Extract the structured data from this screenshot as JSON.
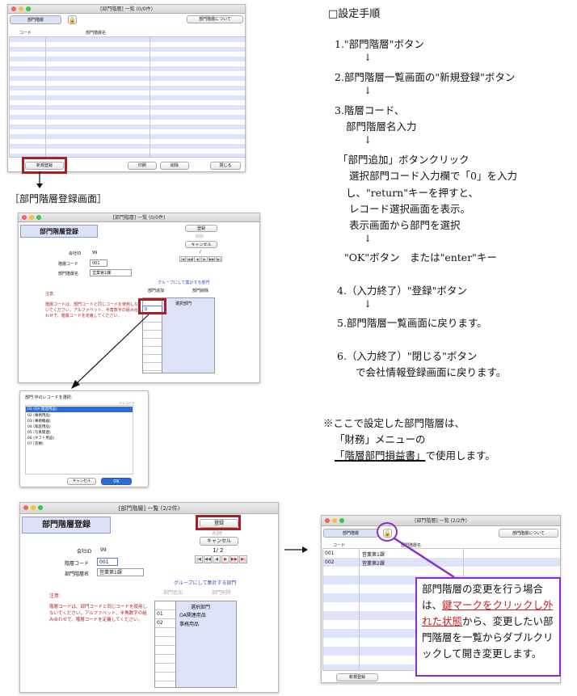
{
  "shot1": {
    "title": "[部門階層] 一覧 (0/0件)",
    "tab_label": "部門階層",
    "about_button": "部門階層について",
    "col_code": "コード",
    "col_name": "部門階層名",
    "new_button": "新規登録",
    "print_button": "印刷",
    "delete_button": "削除",
    "close_button": "閉じる"
  },
  "caption_register": "［部門階層登録画面］",
  "shot2": {
    "title": "[部門階層] 一覧 (0/0件)",
    "heading": "部門階層登録",
    "register_button": "登録",
    "delete_button": "削除",
    "cancel_button": "キャンセル",
    "page_indicator": "/",
    "company_id_label": "会社ID",
    "company_id_value": "99",
    "code_label": "階層コード",
    "code_value": "001",
    "name_label": "部門階層名",
    "name_value": "営業第1課",
    "group_label": "グループにして集計する部門",
    "add_dept_button": "部門追加",
    "remove_dept_button": "部門削除",
    "note_title": "注意:",
    "note_text": "階層コードは、部門コードと同じコードを使用しないでください。アルファベット、半角数字の組み合わせで、階層コードを定義してください。",
    "input_value": "0",
    "selected_header": "選択部門"
  },
  "shot3": {
    "title": "部門 中のレコードを選択:",
    "filter_label": "テレコード",
    "items": [
      "01 (OA 関連用品)",
      "02 (事務用品)",
      "03 (事務機器)",
      "04 (家庭用品)",
      "05 (写真関連)",
      "06 (ギフト用品)",
      "07 (衣類)"
    ],
    "cancel_button": "キャンセル",
    "ok_button": "OK"
  },
  "shot4": {
    "title": "[部門階層] 一覧 (2/2件)",
    "heading": "部門階層登録",
    "register_button": "登録",
    "delete_button": "削除",
    "cancel_button": "キャンセル",
    "page_indicator": "1/ 2",
    "company_id_label": "会社ID",
    "company_id_value": "99",
    "code_label": "階層コード",
    "code_value": "001",
    "name_label": "部門階層名",
    "name_value": "営業第1課",
    "group_label": "グループにして集計する部門",
    "add_dept_button": "部門追加",
    "remove_dept_button": "部門削除",
    "note_title": "注意:",
    "note_text": "階層コードは、部門コードと同じコードを使用しないでください。アルファベット、半角数字の組み合わせで、階層コードを定義してください。",
    "selected_header": "選択部門",
    "rows": [
      {
        "code": "01",
        "name": "OA関連用品"
      },
      {
        "code": "02",
        "name": "事務用品"
      }
    ]
  },
  "shot5": {
    "title": "[部門階層] 一覧 (2/2件)",
    "tab_label": "部門階層",
    "about_button": "部門階層について",
    "col_code": "コード",
    "col_name": "部門階層名",
    "rows": [
      {
        "code": "001",
        "name": "営業第1課"
      },
      {
        "code": "002",
        "name": "営業第2課"
      }
    ],
    "new_button": "新規登録"
  },
  "callout": {
    "part1": "部門階層の変更を行う場合は、",
    "highlight": "鍵マークをクリックし外れた状態",
    "part2": "から、変更したい部門階層を一覧からダブルクリックして開き変更します。"
  },
  "instructions": {
    "title": "□設定手順",
    "step1": "1.\"部門階層\"ボタン",
    "step2": "2.部門階層一覧画面の\"新規登録\"ボタン",
    "step3a": "3.階層コード、",
    "step3b": "部門階層名入力",
    "sub1": "「部門追加」ボタンクリック",
    "sub2": "選択部門コード入力欄で「0」を入力",
    "sub3": "し、\"return\"キーを押すと、",
    "sub4": "レコード選択画面を表示。",
    "sub5": "表示画面から部門を選択",
    "ok_line": "\"OK\"ボタン　または\"enter\"キー",
    "step4": "4.（入力終了）\"登録\"ボタン",
    "step5": "5.部門階層一覧画面に戻ります。",
    "step6": "6.（入力終了）\"閉じる\"ボタン",
    "step6b": "で会社情報登録画面に戻ります。",
    "arrow": "↓"
  },
  "note": {
    "line1": "※ここで設定した部門階層は、",
    "line2": "「財務」メニューの",
    "line3_underlined": "「階層部門損益書」",
    "line3_rest": "で使用します。"
  }
}
